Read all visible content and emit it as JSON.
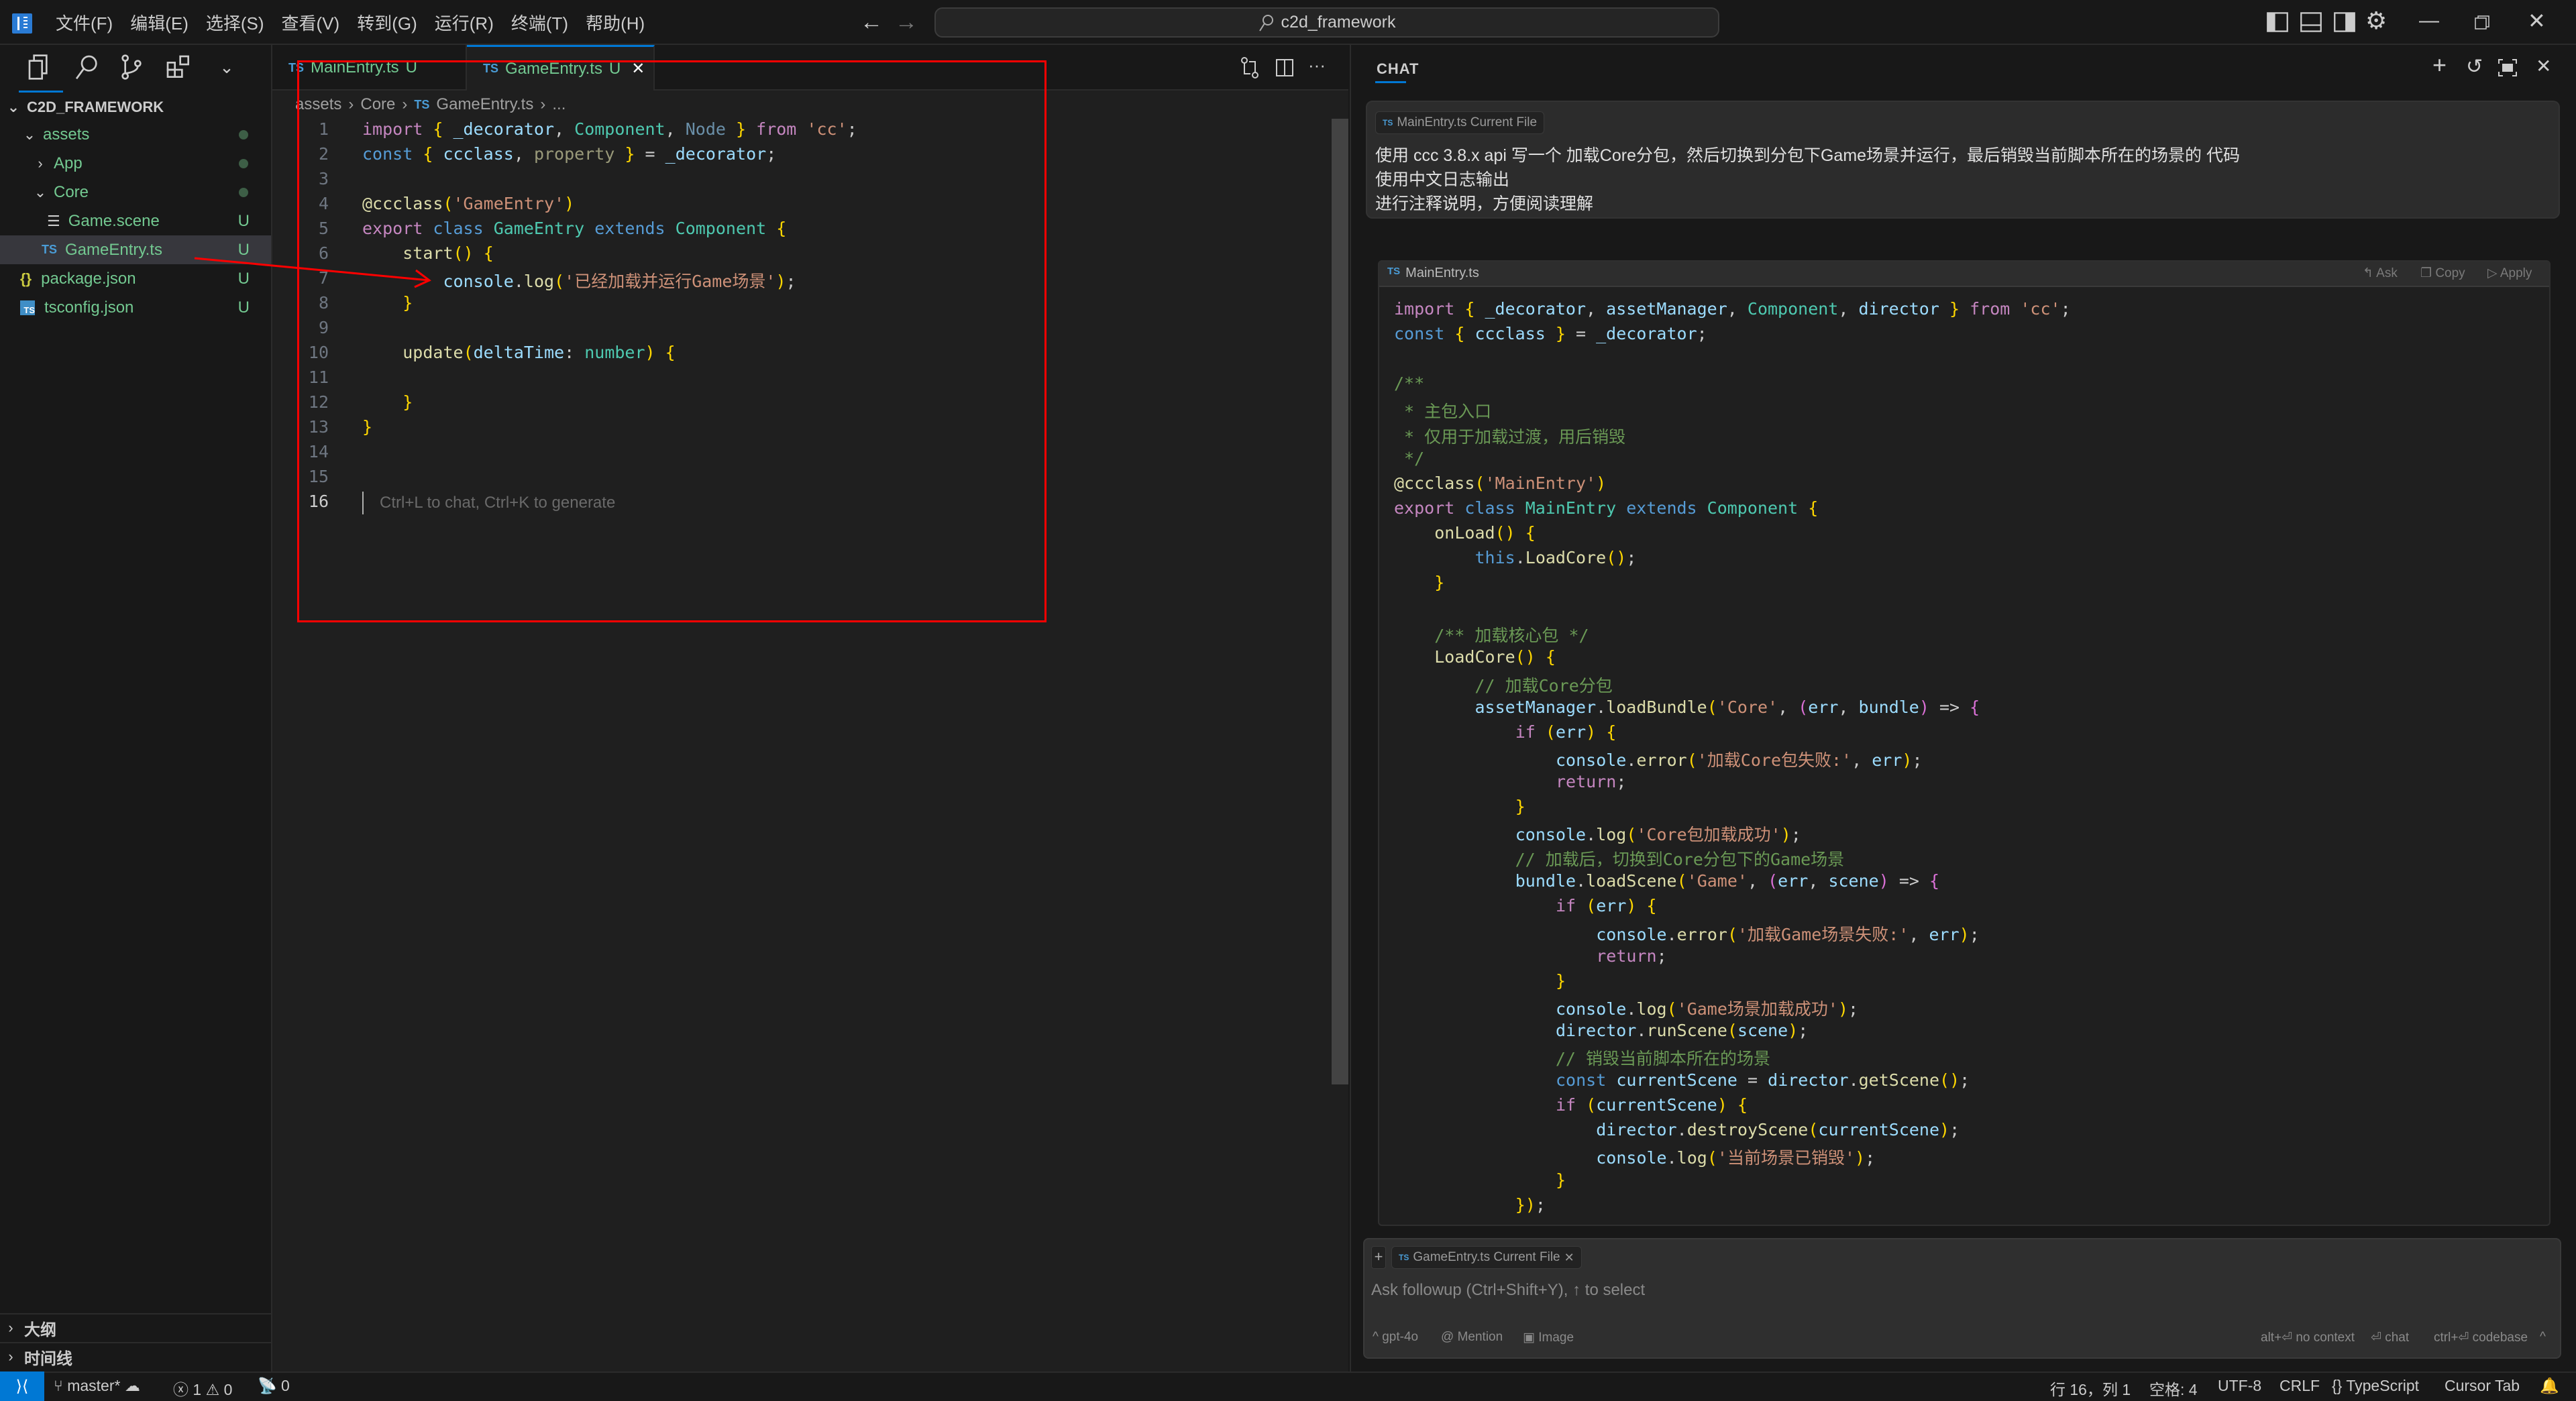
{
  "titlebar": {
    "menu": [
      "文件(F)",
      "编辑(E)",
      "选择(S)",
      "查看(V)",
      "转到(G)",
      "运行(R)",
      "终端(T)",
      "帮助(H)"
    ],
    "search_text": "c2d_framework",
    "icons": [
      "toggle-primary-sidebar-icon",
      "toggle-panel-icon",
      "toggle-secondary-sidebar-icon",
      "settings-gear-icon"
    ],
    "window_controls": [
      "minimize-icon",
      "restore-icon",
      "close-icon"
    ]
  },
  "sidebar": {
    "toolbar_icons": [
      "files-icon",
      "search-icon",
      "source-control-icon",
      "extensions-icon",
      "chevron-down-icon"
    ],
    "root": "C2D_FRAMEWORK",
    "tree": [
      {
        "label": "assets",
        "type": "folder",
        "expanded": true,
        "depth": 1,
        "status": "dot"
      },
      {
        "label": "App",
        "type": "folder",
        "expanded": false,
        "depth": 2,
        "status": "dot"
      },
      {
        "label": "Core",
        "type": "folder",
        "expanded": true,
        "depth": 2,
        "status": "dot"
      },
      {
        "label": "Game.scene",
        "type": "scene",
        "depth": 3,
        "status": "U"
      },
      {
        "label": "GameEntry.ts",
        "type": "ts",
        "depth": 3,
        "status": "U",
        "selected": true
      },
      {
        "label": "package.json",
        "type": "json",
        "depth": 1,
        "status": "U"
      },
      {
        "label": "tsconfig.json",
        "type": "tsconfig",
        "depth": 1,
        "status": "U"
      }
    ],
    "sections": [
      "大纲",
      "时间线"
    ]
  },
  "editor": {
    "tabs": [
      {
        "label": "MainEntry.ts",
        "status": "U",
        "active": false
      },
      {
        "label": "GameEntry.ts",
        "status": "U",
        "active": true
      }
    ],
    "breadcrumb": [
      "assets",
      "Core",
      "GameEntry.ts",
      "..."
    ],
    "lines": [
      "import { _decorator, Component, Node } from 'cc';",
      "const { ccclass, property } = _decorator;",
      "",
      "@ccclass('GameEntry')",
      "export class GameEntry extends Component {",
      "    start() {",
      "        console.log('已经加载并运行Game场景');",
      "    }",
      "",
      "    update(deltaTime: number) {",
      "",
      "    }",
      "}",
      "",
      "",
      ""
    ],
    "current_line": 16,
    "ghost_hint": "Ctrl+L to chat, Ctrl+K to generate"
  },
  "chat": {
    "title": "CHAT",
    "header_icons": [
      "new-chat-icon",
      "history-icon",
      "maximize-icon",
      "close-icon"
    ],
    "user_message": {
      "context_pill": "MainEntry.ts Current File",
      "lines": [
        "使用 ccc 3.8.x api 写一个 加载Core分包，然后切换到分包下Game场景并运行，最后销毁当前脚本所在的场景的 代码",
        "使用中文日志输出",
        "进行注释说明，方便阅读理解"
      ]
    },
    "code_block": {
      "filename": "MainEntry.ts",
      "actions": [
        "Ask",
        "Copy",
        "Apply"
      ],
      "lines": [
        "import { _decorator, assetManager, Component, director } from 'cc';",
        "const { ccclass } = _decorator;",
        "",
        "/**",
        " * 主包入口",
        " * 仅用于加载过渡，用后销毁",
        " */",
        "@ccclass('MainEntry')",
        "export class MainEntry extends Component {",
        "    onLoad() {",
        "        this.LoadCore();",
        "    }",
        "",
        "    /** 加载核心包 */",
        "    LoadCore() {",
        "        // 加载Core分包",
        "        assetManager.loadBundle('Core', (err, bundle) => {",
        "            if (err) {",
        "                console.error('加载Core包失败:', err);",
        "                return;",
        "            }",
        "            console.log('Core包加载成功');",
        "            // 加载后，切换到Core分包下的Game场景",
        "            bundle.loadScene('Game', (err, scene) => {",
        "                if (err) {",
        "                    console.error('加载Game场景失败:', err);",
        "                    return;",
        "                }",
        "                console.log('Game场景加载成功');",
        "                director.runScene(scene);",
        "                // 销毁当前脚本所在的场景",
        "                const currentScene = director.getScene();",
        "                if (currentScene) {",
        "                    director.destroyScene(currentScene);",
        "                    console.log('当前场景已销毁');",
        "                }",
        "            });"
      ]
    },
    "input": {
      "context_pill": "GameEntry.ts Current File",
      "placeholder": "Ask followup (Ctrl+Shift+Y), ↑ to select",
      "model": "gpt-4o",
      "mention": "Mention",
      "image": "Image",
      "hints": [
        "alt+⏎ no context",
        "⏎ chat",
        "ctrl+⏎ codebase"
      ]
    }
  },
  "statusbar": {
    "branch": "master*",
    "errors": "1",
    "warnings": "0",
    "ports": "0",
    "position": "行 16，列 1",
    "indent": "空格: 4",
    "encoding": "UTF-8",
    "eol": "CRLF",
    "language": "TypeScript",
    "cursor_tab": "Cursor Tab"
  },
  "colors": {
    "accent": "#0078d4",
    "untracked": "#73c991",
    "annotation": "#ff0000"
  }
}
